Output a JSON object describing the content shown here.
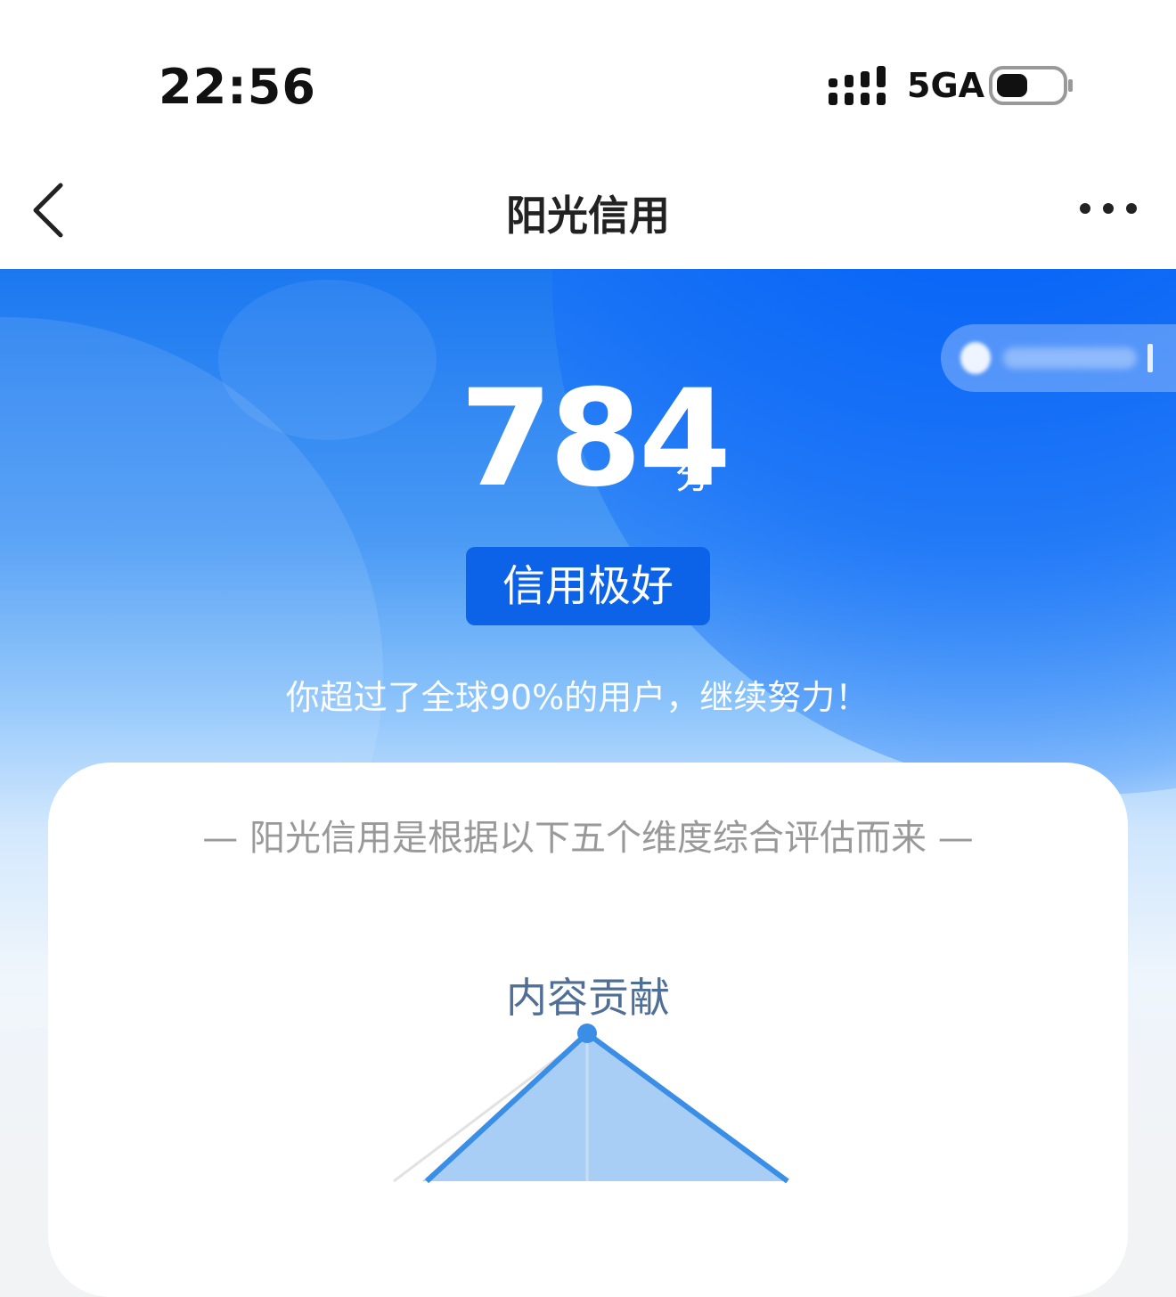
{
  "status_bar": {
    "time": "22:56",
    "network": "5GA",
    "signal_icon": "signal-bars-icon",
    "battery_icon": "battery-icon"
  },
  "nav": {
    "title": "阳光信用",
    "back_icon": "back-chevron-icon",
    "more_icon": "more-dots-icon"
  },
  "hero": {
    "score": "784",
    "score_unit": "分",
    "level": "信用极好",
    "rank_text": "你超过了全球90%的用户，继续努力！",
    "user_pill_icon": "chevron-right-icon"
  },
  "card": {
    "caption": "— 阳光信用是根据以下五个维度综合评估而来 —",
    "dimensions": [
      {
        "label": "内容贡献"
      }
    ]
  },
  "colors": {
    "primary": "#0d63e8",
    "hero_top": "#1b78f0",
    "radar_stroke": "#3a8ee6",
    "radar_fill": "#a9cef5",
    "dimension_label": "#4f6f96"
  }
}
